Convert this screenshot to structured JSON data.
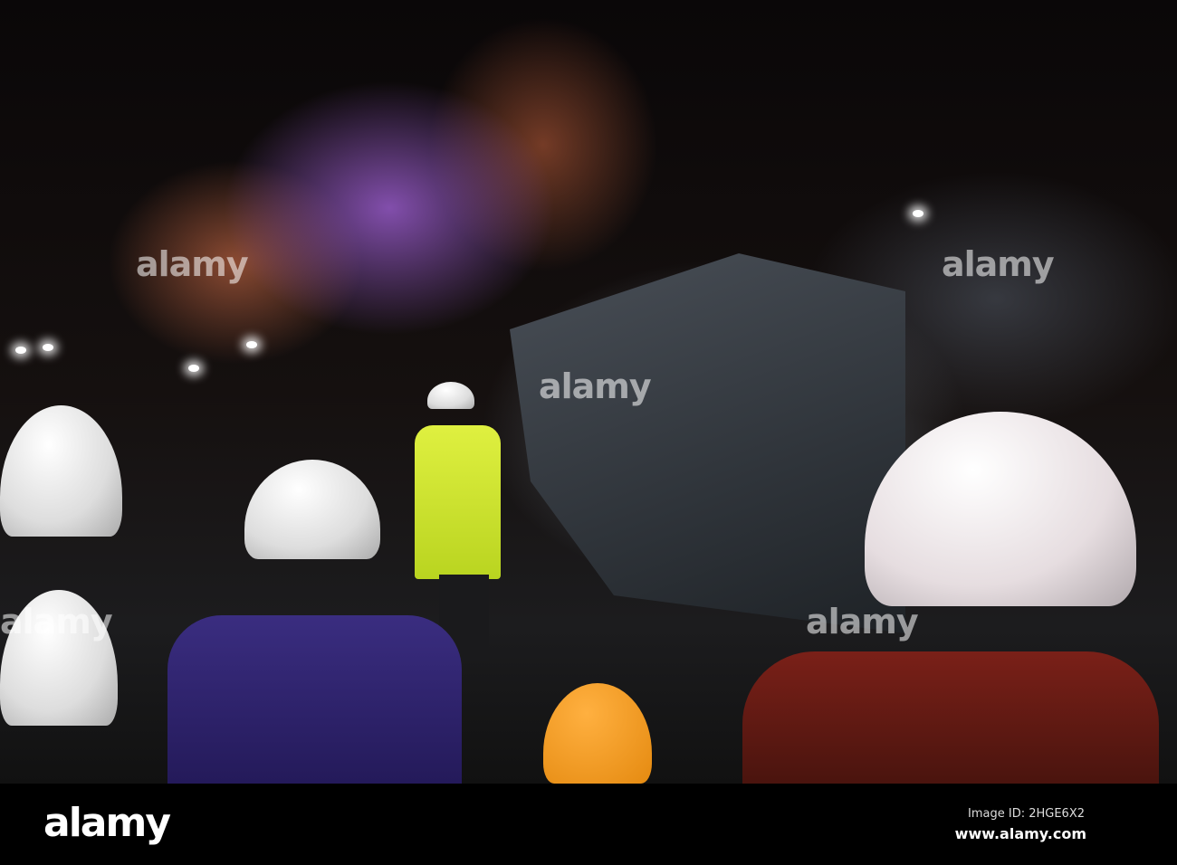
{
  "photo": {
    "subject": "guided tour group in hard hats inside slate mine cavern",
    "watermark": "alamy"
  },
  "footer": {
    "logo": "alamy",
    "image_id": "Image ID: 2HGE6X2",
    "site": "www.alamy.com"
  }
}
